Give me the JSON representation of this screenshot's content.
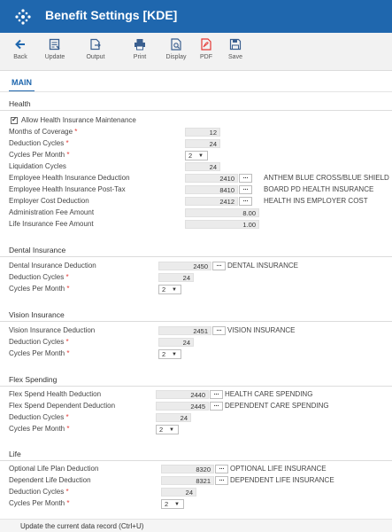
{
  "window": {
    "title": "Benefit Settings [KDE]"
  },
  "toolbar": {
    "back": "Back",
    "update": "Update",
    "output": "Output",
    "print": "Print",
    "display": "Display",
    "pdf": "PDF",
    "save": "Save"
  },
  "tabs": {
    "main": "MAIN"
  },
  "health": {
    "title": "Health",
    "allow_label": "Allow Health Insurance Maintenance",
    "allow_checked": true,
    "months_label": "Months of Coverage",
    "months_value": "12",
    "deduction_cycles_label": "Deduction Cycles",
    "deduction_cycles_value": "24",
    "cycles_per_month_label": "Cycles Per Month",
    "cycles_per_month_value": "2",
    "liquidation_label": "Liquidation Cycles",
    "liquidation_value": "24",
    "emp_ded_label": "Employee Health Insurance Deduction",
    "emp_ded_code": "2410",
    "emp_ded_desc": "ANTHEM BLUE CROSS/BLUE SHIELD",
    "emp_post_label": "Employee Health Insurance Post-Tax",
    "emp_post_code": "8410",
    "emp_post_desc": "BOARD PD HEALTH INSURANCE",
    "employer_label": "Employer Cost Deduction",
    "employer_code": "2412",
    "employer_desc": "HEALTH INS EMPLOYER COST",
    "admin_fee_label": "Administration Fee Amount",
    "admin_fee_value": "8.00",
    "life_fee_label": "Life Insurance Fee Amount",
    "life_fee_value": "1.00"
  },
  "dental": {
    "title": "Dental Insurance",
    "ded_label": "Dental Insurance Deduction",
    "ded_code": "2450",
    "ded_desc": "DENTAL INSURANCE",
    "cycles_label": "Deduction Cycles",
    "cycles_value": "24",
    "cpm_label": "Cycles Per Month",
    "cpm_value": "2"
  },
  "vision": {
    "title": "Vision Insurance",
    "ded_label": "Vision Insurance Deduction",
    "ded_code": "2451",
    "ded_desc": "VISION INSURANCE",
    "cycles_label": "Deduction Cycles",
    "cycles_value": "24",
    "cpm_label": "Cycles Per Month",
    "cpm_value": "2"
  },
  "flex": {
    "title": "Flex Spending",
    "health_label": "Flex Spend Health Deduction",
    "health_code": "2440",
    "health_desc": "HEALTH CARE SPENDING",
    "dep_label": "Flex Spend Dependent Deduction",
    "dep_code": "2445",
    "dep_desc": "DEPENDENT CARE SPENDING",
    "cycles_label": "Deduction Cycles",
    "cycles_value": "24",
    "cpm_label": "Cycles Per Month",
    "cpm_value": "2"
  },
  "life": {
    "title": "Life",
    "opt_label": "Optional Life Plan Deduction",
    "opt_code": "8320",
    "opt_desc": "OPTIONAL LIFE INSURANCE",
    "dep_label": "Dependent Life Deduction",
    "dep_code": "8321",
    "dep_desc": "DEPENDENT LIFE INSURANCE",
    "cycles_label": "Deduction Cycles",
    "cycles_value": "24",
    "cpm_label": "Cycles Per Month",
    "cpm_value": "2"
  },
  "status": {
    "text": "Update the current data record (Ctrl+U)"
  }
}
